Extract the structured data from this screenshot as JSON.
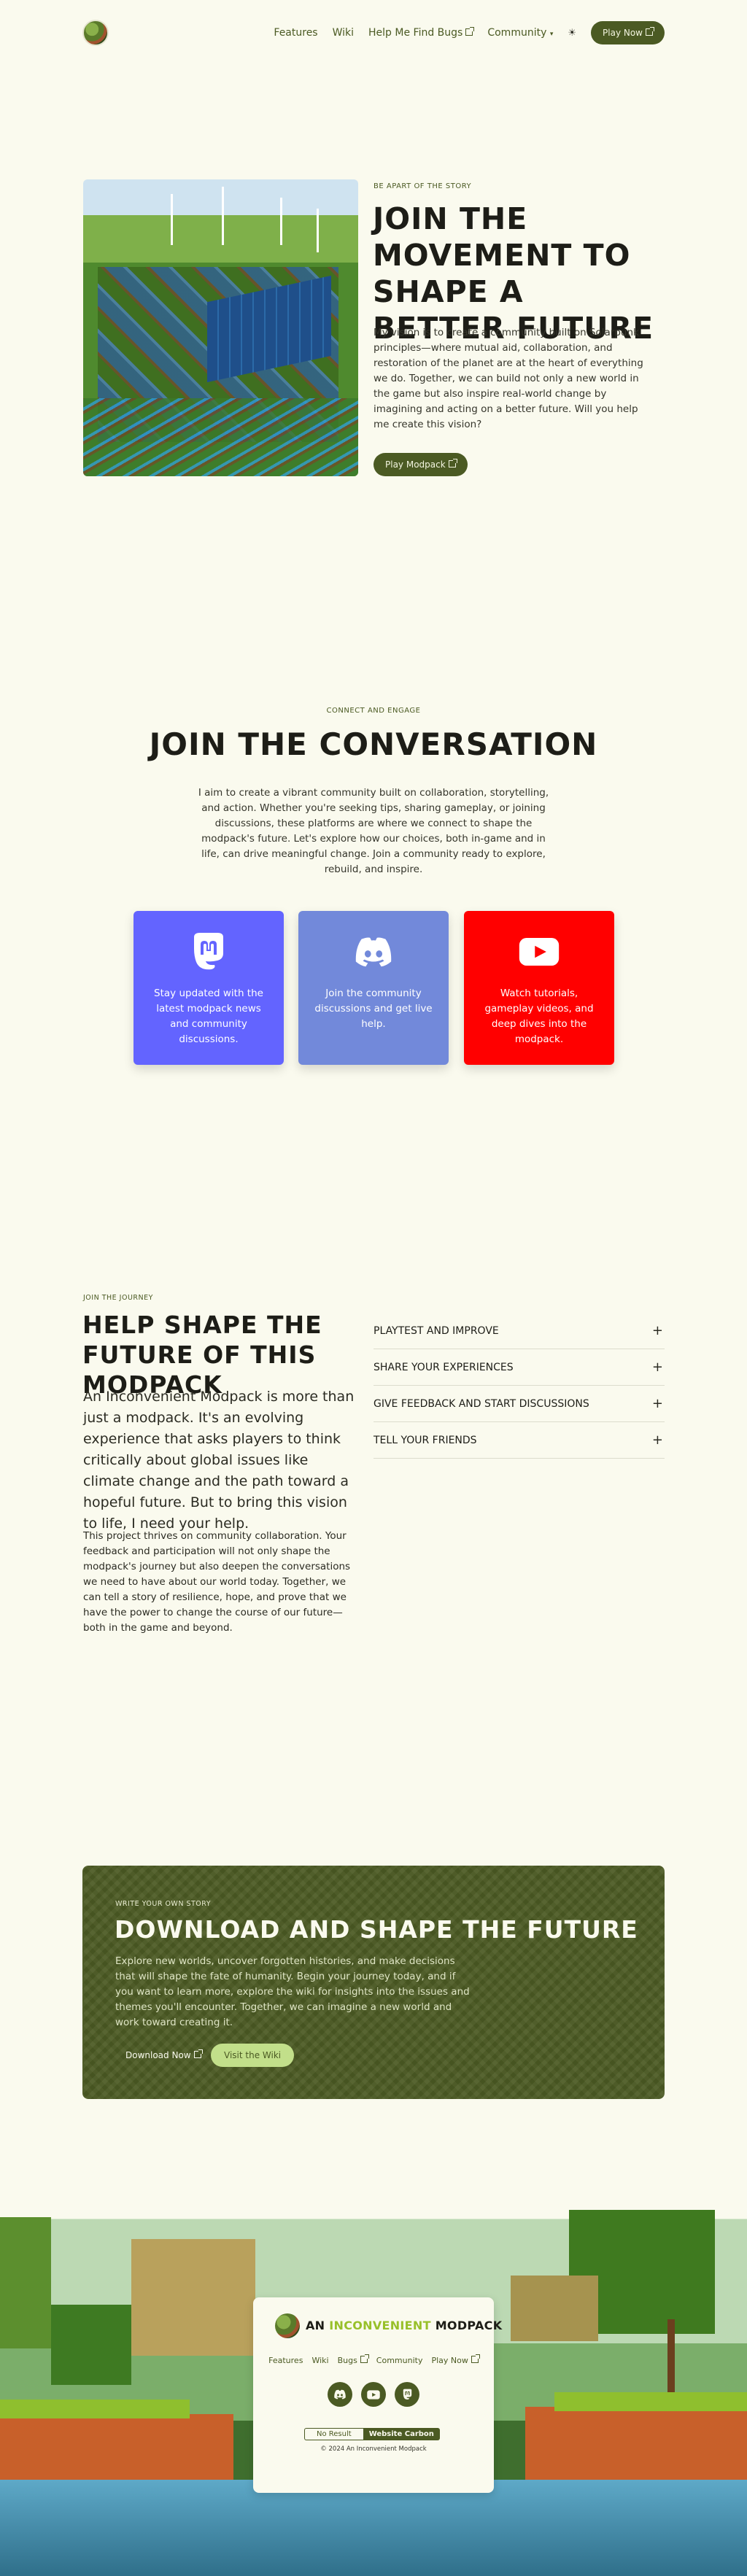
{
  "nav": {
    "links": [
      "Features",
      "Wiki",
      "Help Me Find Bugs",
      "Community"
    ],
    "community_caret": "▾",
    "theme_icon": "☀",
    "play_label": "Play Now"
  },
  "hero": {
    "eyebrow": "BE APART OF THE STORY",
    "title": "JOIN THE MOVEMENT TO SHAPE A BETTER FUTURE",
    "text": "My vision is to create a community built on Solarpunk principles—where mutual aid, collaboration, and restoration of the planet are at the heart of everything we do. Together, we can build not only a new world in the game but also inspire real-world change by imagining and acting on a better future. Will you help me create this vision?",
    "button": "Play Modpack"
  },
  "conversation": {
    "eyebrow": "CONNECT AND ENGAGE",
    "title": "JOIN THE CONVERSATION",
    "text": "I aim to create a vibrant community built on collaboration, storytelling, and action. Whether you're seeking tips, sharing gameplay, or joining discussions, these platforms are where we connect to shape the modpack's future. Let's explore how our choices, both in-game and in life, can drive meaningful change. Join a community ready to explore, rebuild, and inspire.",
    "cards": [
      {
        "icon": "mastodon-icon",
        "text": "Stay updated with the latest modpack news and community discussions.",
        "color": "#6364ff"
      },
      {
        "icon": "discord-icon",
        "text": "Join the community discussions and get live help.",
        "color": "#7289da"
      },
      {
        "icon": "youtube-icon",
        "text": "Watch tutorials, gameplay videos, and deep dives into the modpack.",
        "color": "#ff0000"
      }
    ]
  },
  "journey": {
    "eyebrow": "JOIN THE JOURNEY",
    "title": "HELP SHAPE THE FUTURE OF THIS MODPACK",
    "lead": "An Inconvenient Modpack is more than just a modpack. It's an evolving experience that asks players to think critically about global issues like climate change and the path toward a hopeful future. But to bring this vision to life, I need your help.",
    "text": "This project thrives on community collaboration. Your feedback and participation will not only shape the modpack's journey but also deepen the conversations we need to have about our world today. Together, we can tell a story of resilience, hope, and prove that we have the power to change the course of our future—both in the game and beyond.",
    "accordion": [
      "PLAYTEST AND IMPROVE",
      "SHARE YOUR EXPERIENCES",
      "GIVE FEEDBACK AND START DISCUSSIONS",
      "TELL YOUR FRIENDS"
    ],
    "plus": "+"
  },
  "cta": {
    "eyebrow": "WRITE YOUR OWN STORY",
    "title": "DOWNLOAD AND SHAPE THE FUTURE",
    "text": "Explore new worlds, uncover forgotten histories, and make decisions that will shape the fate of humanity. Begin your journey today, and if you want to learn more, explore the wiki for insights into the issues and themes you'll encounter. Together, we can imagine a new world and work toward creating it.",
    "download": "Download Now",
    "wiki": "Visit the Wiki"
  },
  "footer": {
    "brand_a": "AN",
    "brand_b": "INCONVENIENT",
    "brand_c": "MODPACK",
    "links": [
      "Features",
      "Wiki",
      "Bugs",
      "Community",
      "Play Now"
    ],
    "social": [
      "discord-icon",
      "youtube-icon",
      "mastodon-icon"
    ],
    "carbon_result": "No Result",
    "carbon_label": "Website Carbon",
    "copyright": "© 2024 An Inconvenient Modpack"
  },
  "colors": {
    "background": "#fafaee",
    "accent": "#4b5a23",
    "light_accent": "#c2df8a",
    "brand_green": "#98c02a"
  }
}
